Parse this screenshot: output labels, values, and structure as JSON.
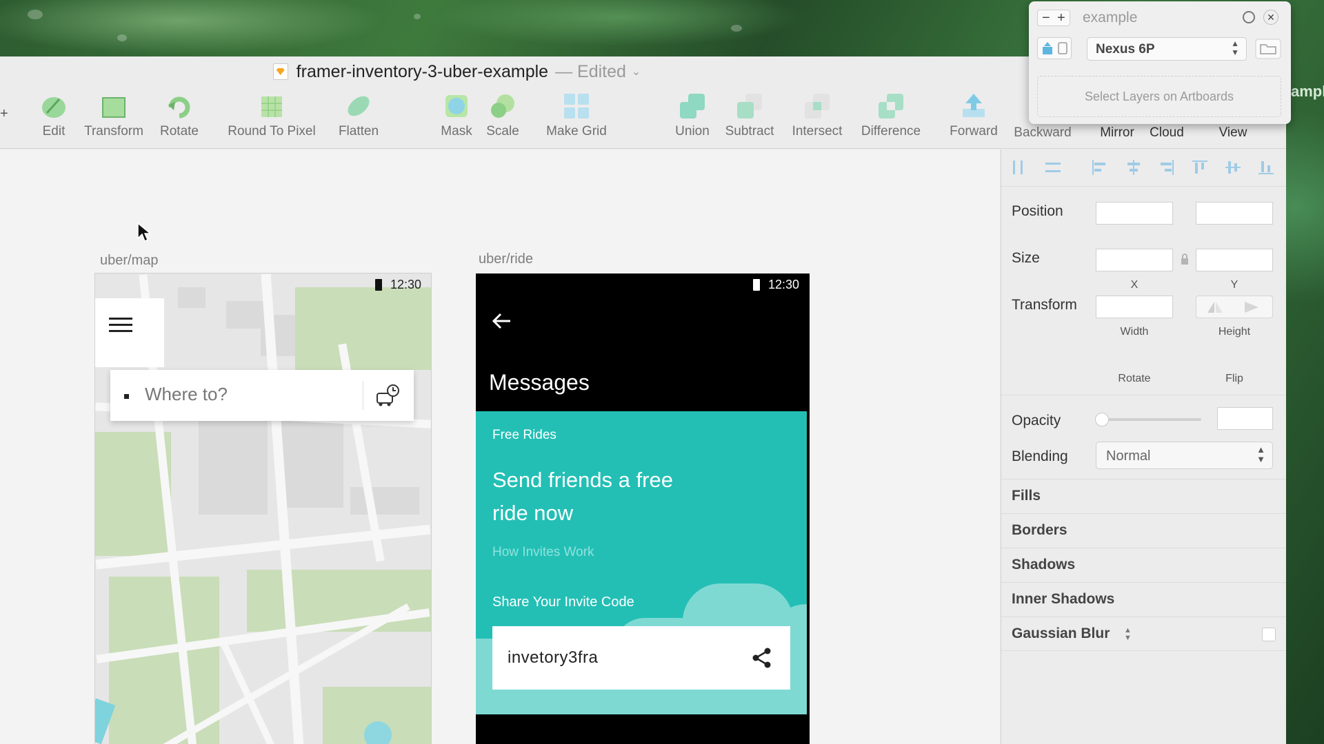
{
  "window": {
    "title": "framer-inventory-3-uber-example",
    "edited_label": "— Edited"
  },
  "toolbar": {
    "tools": [
      {
        "label": "Edit",
        "icon": "edit-icon"
      },
      {
        "label": "Transform",
        "icon": "transform-icon"
      },
      {
        "label": "Rotate",
        "icon": "rotate-icon"
      },
      {
        "label": "Round To Pixel",
        "icon": "round-to-pixel-icon"
      },
      {
        "label": "Flatten",
        "icon": "flatten-icon"
      },
      {
        "label": "Mask",
        "icon": "mask-icon"
      },
      {
        "label": "Scale",
        "icon": "scale-icon"
      },
      {
        "label": "Make Grid",
        "icon": "make-grid-icon"
      },
      {
        "label": "Union",
        "icon": "union-icon"
      },
      {
        "label": "Subtract",
        "icon": "subtract-icon"
      },
      {
        "label": "Intersect",
        "icon": "intersect-icon"
      },
      {
        "label": "Difference",
        "icon": "difference-icon"
      },
      {
        "label": "Forward",
        "icon": "forward-icon"
      },
      {
        "label": "Backward",
        "icon": "backward-icon"
      },
      {
        "label": "Mirror",
        "icon": "mirror-icon"
      },
      {
        "label": "Cloud",
        "icon": "cloud-icon"
      },
      {
        "label": "View",
        "icon": "view-icon"
      }
    ]
  },
  "canvas": {
    "map_artboard": {
      "label": "uber/map",
      "status_time": "12:30",
      "search_placeholder": "Where to?"
    },
    "ride_artboard": {
      "label": "uber/ride",
      "status_time": "12:30",
      "header_title": "Messages",
      "promo_tag": "Free Rides",
      "promo_headline_1": "Send friends a free",
      "promo_headline_2": "ride now",
      "promo_link": "How Invites Work",
      "share_label": "Share Your Invite Code",
      "invite_code": "invetory3fra"
    }
  },
  "inspector": {
    "position_label": "Position",
    "x_label": "X",
    "y_label": "Y",
    "size_label": "Size",
    "width_label": "Width",
    "height_label": "Height",
    "transform_label": "Transform",
    "rotate_label": "Rotate",
    "flip_label": "Flip",
    "opacity_label": "Opacity",
    "blending_label": "Blending",
    "blending_value": "Normal",
    "sections": [
      "Fills",
      "Borders",
      "Shadows",
      "Inner Shadows",
      "Gaussian Blur"
    ]
  },
  "mirror_panel": {
    "title": "example",
    "device": "Nexus 6P",
    "hint": "Select Layers on Artboards",
    "edge_text": "ampl"
  },
  "colors": {
    "teal": "#23bfb5",
    "teal_light": "#7fd9d3",
    "toolbar_icon": "#8fd8b4"
  }
}
